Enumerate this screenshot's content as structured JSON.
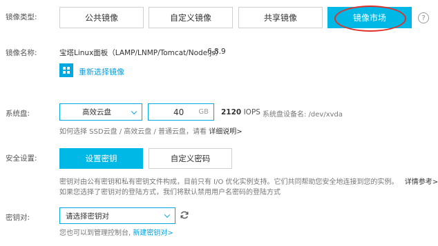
{
  "image_type": {
    "label": "镜像类型:",
    "tabs": [
      {
        "label": "公共镜像",
        "active": false
      },
      {
        "label": "自定义镜像",
        "active": false
      },
      {
        "label": "共享镜像",
        "active": false
      },
      {
        "label": "镜像市场",
        "active": true
      }
    ],
    "help_symbol": "?",
    "highlight_color": "#e0302a"
  },
  "image_name": {
    "label": "镜像名称:",
    "value": "宝塔Linux面板（LAMP/LNMP/Tomcat/Node.js）",
    "version": "6.8.9",
    "reselect_label": "重新选择镜像"
  },
  "system_disk": {
    "label": "系统盘:",
    "type_value": "高效云盘",
    "size_value": "40",
    "size_unit": "GB",
    "iops_number": "2120",
    "iops_unit": "IOPS",
    "device_label": "系统盘设备名: /dev/xvda",
    "hint_prefix": "如何选择 SSD云盘 / 高效云盘 / 普通云盘，请看",
    "hint_link": "详细说明>"
  },
  "security": {
    "label": "安全设置:",
    "options": [
      {
        "label": "设置密钥",
        "active": true
      },
      {
        "label": "自定义密码",
        "active": false
      }
    ],
    "desc_line1": "密钥对由公有密钥和私有密钥文件构成，目前只有 I/O 优化实例支持。它们共同帮助您安全地连接到您的实例。",
    "desc_link": "详情参考>",
    "desc_line2": "如果您选择了密钥对的登陆方式，我们将默认禁用用户名密码的登陆方式"
  },
  "keypair": {
    "label": "密钥对:",
    "select_placeholder": "请选择密钥对",
    "hint_prefix": "您也可以到管理控制台,",
    "hint_link": "新建密钥对>"
  },
  "colors": {
    "accent": "#00b8e6",
    "link": "#00a0e0"
  }
}
